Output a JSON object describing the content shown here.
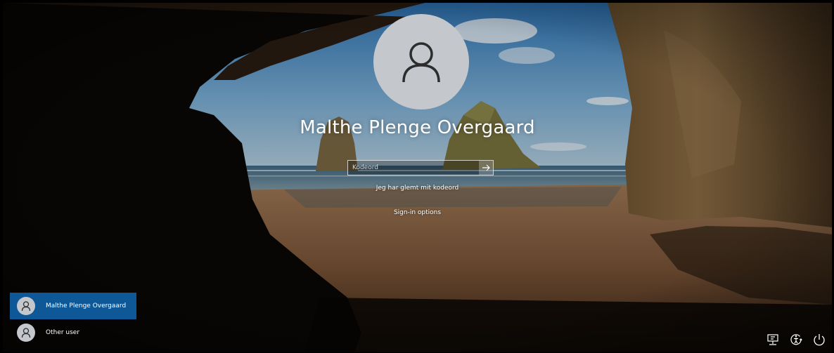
{
  "login": {
    "user_name": "Malthe Plenge Overgaard",
    "password_placeholder": "Kodeord",
    "forgot_password": "Jeg har glemt mit kodeord",
    "sign_in_options": "Sign-in options",
    "submit_icon": "arrow-right-icon",
    "avatar_icon": "user-icon"
  },
  "user_list": {
    "items": [
      {
        "label": "Malthe Plenge Overgaard",
        "selected": true
      },
      {
        "label": "Other user",
        "selected": false
      }
    ]
  },
  "tray": {
    "icons": [
      "network-icon",
      "ease-of-access-icon",
      "power-icon"
    ]
  },
  "colors": {
    "selected_user": "#0e5897",
    "avatar_bg": "#c4c8cd"
  }
}
